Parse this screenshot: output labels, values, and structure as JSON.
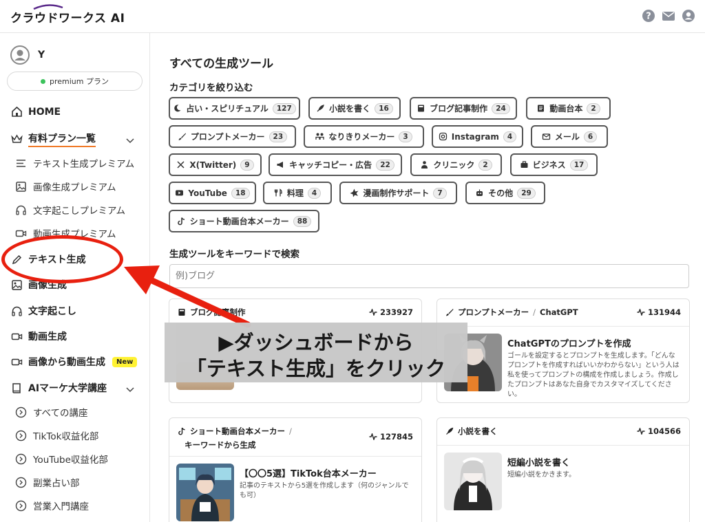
{
  "header": {
    "logo": "クラウドワークス AI"
  },
  "user": {
    "name": "Y",
    "plan_label": "premium プラン"
  },
  "sidebar": {
    "home": "HOME",
    "paid_plans": "有料プラン一覧",
    "paid_items": [
      "テキスト生成プレミアム",
      "画像生成プレミアム",
      "文字起こしプレミアム",
      "動画生成プレミアム"
    ],
    "text_gen": "テキスト生成",
    "image_gen": "画像生成",
    "transcribe": "文字起こし",
    "video_gen": "動画生成",
    "img2video": "画像から動画生成",
    "new_badge": "New",
    "university": "AIマーケ大学講座",
    "courses": [
      "すべての講座",
      "TikTok収益化部",
      "YouTube収益化部",
      "副業占い部",
      "営業入門講座"
    ]
  },
  "main": {
    "title": "すべての生成ツール",
    "category_label": "カテゴリを絞り込む",
    "categories": [
      {
        "label": "占い・スピリチュアル",
        "count": "127",
        "icon": "moon-icon"
      },
      {
        "label": "小説を書く",
        "count": "16",
        "icon": "feather-icon"
      },
      {
        "label": "ブログ記事制作",
        "count": "24",
        "icon": "book-icon"
      },
      {
        "label": "動画台本",
        "count": "2",
        "icon": "script-icon"
      },
      {
        "label": "プロンプトメーカー",
        "count": "23",
        "icon": "brush-icon"
      },
      {
        "label": "なりきりメーカー",
        "count": "3",
        "icon": "people-icon"
      },
      {
        "label": "Instagram",
        "count": "4",
        "icon": "instagram-icon"
      },
      {
        "label": "メール",
        "count": "6",
        "icon": "mail-icon"
      },
      {
        "label": "X(Twitter)",
        "count": "9",
        "icon": "x-icon"
      },
      {
        "label": "キャッチコピー・広告",
        "count": "22",
        "icon": "megaphone-icon"
      },
      {
        "label": "クリニック",
        "count": "2",
        "icon": "doctor-icon"
      },
      {
        "label": "ビジネス",
        "count": "17",
        "icon": "briefcase-icon"
      },
      {
        "label": "YouTube",
        "count": "18",
        "icon": "youtube-icon"
      },
      {
        "label": "料理",
        "count": "4",
        "icon": "cutlery-icon"
      },
      {
        "label": "漫画制作サポート",
        "count": "7",
        "icon": "burst-icon"
      },
      {
        "label": "その他",
        "count": "29",
        "icon": "robot-icon"
      },
      {
        "label": "ショート動画台本メーカー",
        "count": "88",
        "icon": "tiktok-icon"
      }
    ],
    "search_label": "生成ツールをキーワードで検索",
    "search_placeholder": "例)ブログ",
    "cards": [
      {
        "category": "ブログ記事制作",
        "count": "233927",
        "title": "",
        "desc": ""
      },
      {
        "category": "プロンプトメーカー",
        "sub": "ChatGPT",
        "count": "131944",
        "title": "ChatGPTのプロンプトを作成",
        "desc": "ゴールを設定するとプロンプトを生成します。「どんなプロンプトを作成すればいいかわからない」という人は私を使ってプロンプトの構成を作成しましょう。作成したプロンプトはあなた自身でカスタマイズしてください。"
      },
      {
        "category": "ショート動画台本メーカー",
        "sub": "キーワードから生成",
        "count": "127845",
        "title": "【〇〇5選】TikTok台本メーカー",
        "desc": "記事のテキストから5選を作成します（何のジャンルでも可）"
      },
      {
        "category": "小説を書く",
        "count": "104566",
        "title": "短編小説を書く",
        "desc": "短編小説をかきます。"
      }
    ]
  },
  "callout": {
    "line1": "▶ダッシュボードから",
    "line2": "「テキスト生成」をクリック"
  },
  "colors": {
    "accent_red": "#e8200f",
    "underline_orange": "#f07a28",
    "new_badge": "#fff233",
    "premium_dot": "#3cc35c"
  }
}
